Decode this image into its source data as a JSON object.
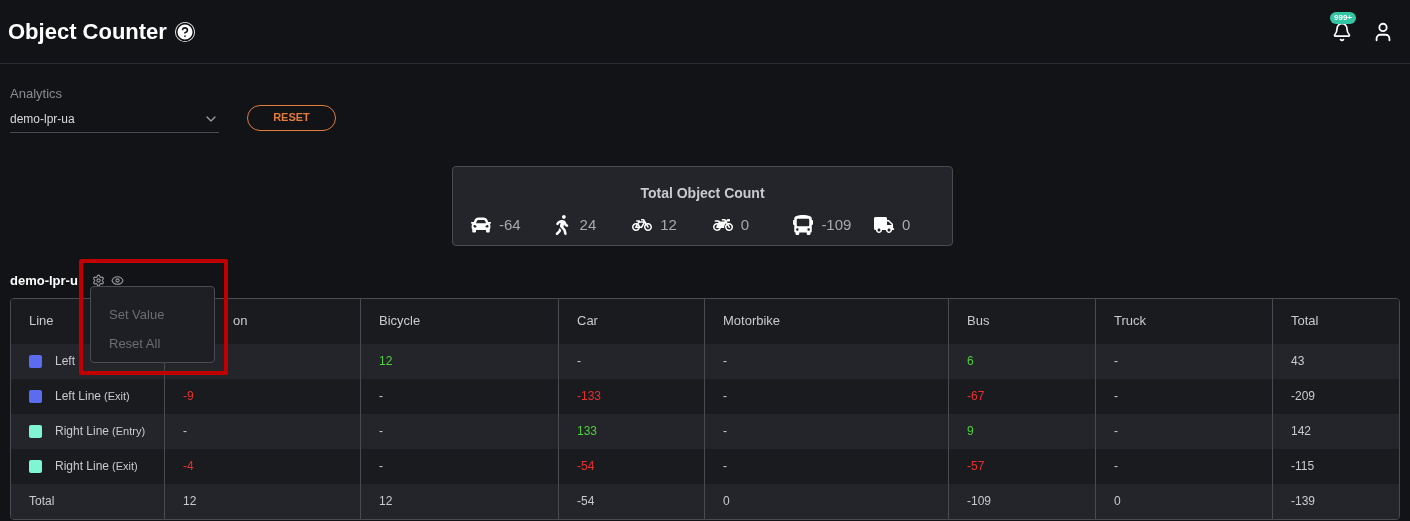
{
  "header": {
    "title": "Object Counter",
    "notifications_badge": "999+"
  },
  "filters": {
    "label": "Analytics",
    "value": "demo-lpr-ua",
    "reset_button": "RESET"
  },
  "totals": {
    "title": "Total Object Count",
    "items": [
      {
        "kind": "car",
        "value": "-64"
      },
      {
        "kind": "person",
        "value": "24"
      },
      {
        "kind": "bicycle",
        "value": "12"
      },
      {
        "kind": "motorbike",
        "value": "0"
      },
      {
        "kind": "bus",
        "value": "-109"
      },
      {
        "kind": "truck",
        "value": "0"
      }
    ]
  },
  "section": {
    "title": "demo-lpr-u",
    "menu": [
      {
        "label": "Set Value",
        "disabled": true
      },
      {
        "label": "Reset All",
        "disabled": true
      }
    ]
  },
  "table": {
    "columns": [
      "Line",
      "on",
      "Bicycle",
      "Car",
      "Motorbike",
      "Bus",
      "Truck",
      "Total"
    ],
    "rows": [
      {
        "color": "#5b6cf0",
        "cells": [
          {
            "text": "Left"
          },
          {
            "text": ""
          },
          {
            "text": "12",
            "color": "#4cd137"
          },
          {
            "text": "-"
          },
          {
            "text": "-"
          },
          {
            "text": "6",
            "color": "#4cd137"
          },
          {
            "text": "-"
          },
          {
            "text": "43"
          }
        ]
      },
      {
        "color": "#5b6cf0",
        "cells": [
          {
            "text": "Left Line",
            "note": "(Exit)"
          },
          {
            "text": "-9",
            "color": "#e8302f"
          },
          {
            "text": "-"
          },
          {
            "text": "-133",
            "color": "#e8302f"
          },
          {
            "text": "-"
          },
          {
            "text": "-67",
            "color": "#e8302f"
          },
          {
            "text": "-"
          },
          {
            "text": "-209"
          }
        ]
      },
      {
        "color": "#7ff5d4",
        "cells": [
          {
            "text": "Right Line",
            "note": "(Entry)"
          },
          {
            "text": "-"
          },
          {
            "text": "-"
          },
          {
            "text": "133",
            "color": "#4cd137"
          },
          {
            "text": "-"
          },
          {
            "text": "9",
            "color": "#4cd137"
          },
          {
            "text": "-"
          },
          {
            "text": "142"
          }
        ]
      },
      {
        "color": "#7ff5d4",
        "cells": [
          {
            "text": "Right Line",
            "note": "(Exit)"
          },
          {
            "text": "-4",
            "color": "#e8302f"
          },
          {
            "text": "-"
          },
          {
            "text": "-54",
            "color": "#e8302f"
          },
          {
            "text": "-"
          },
          {
            "text": "-57",
            "color": "#e8302f"
          },
          {
            "text": "-"
          },
          {
            "text": "-115"
          }
        ]
      },
      {
        "cells": [
          {
            "text": "Total"
          },
          {
            "text": "12"
          },
          {
            "text": "12"
          },
          {
            "text": "-54"
          },
          {
            "text": "0"
          },
          {
            "text": "-109"
          },
          {
            "text": "0"
          },
          {
            "text": "-139"
          }
        ]
      }
    ]
  }
}
